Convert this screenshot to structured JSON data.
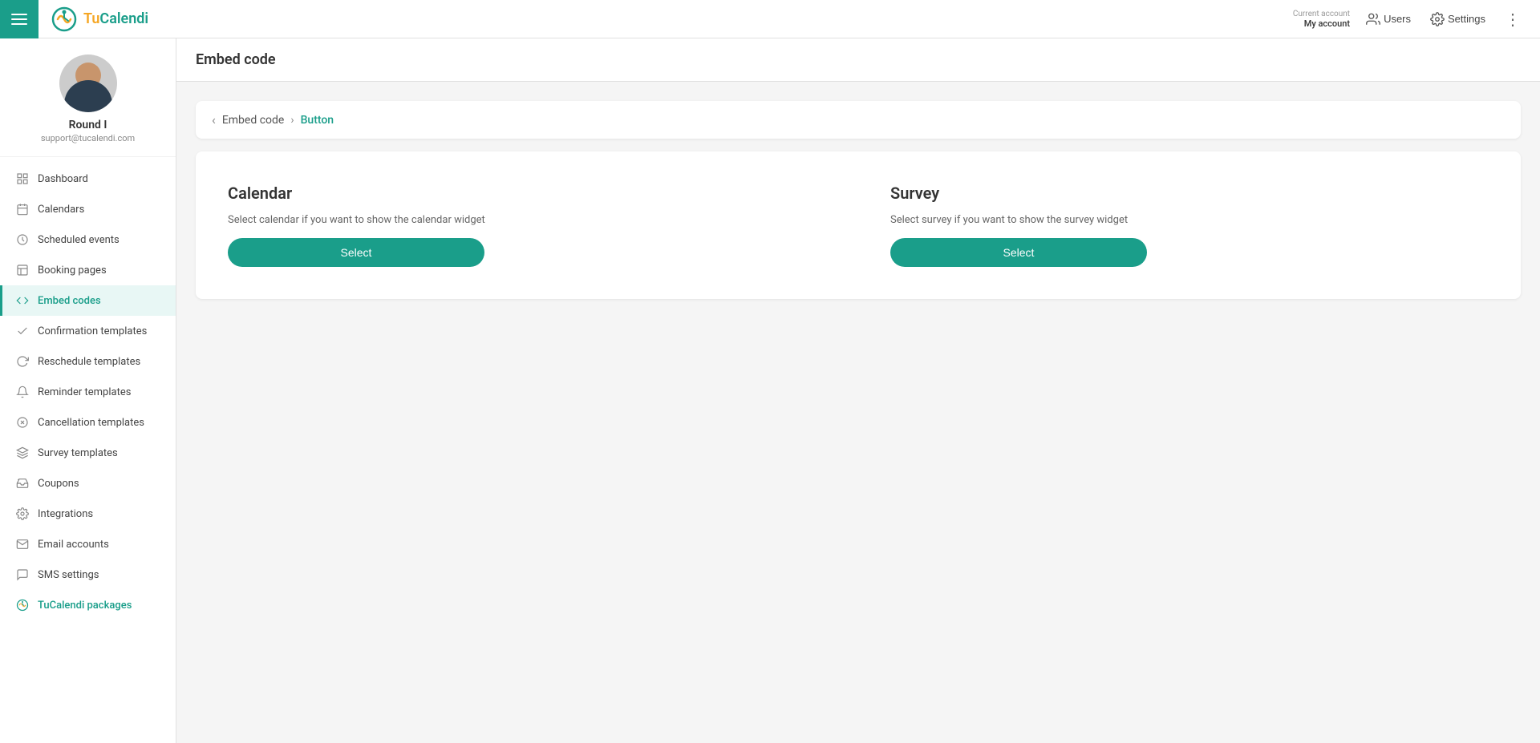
{
  "topbar": {
    "hamburger_label": "Menu",
    "logo_tu": "Tu",
    "logo_calendi": "Calendi",
    "account_label": "Current account",
    "account_name": "My account",
    "users_label": "Users",
    "settings_label": "Settings",
    "more_label": "More"
  },
  "sidebar": {
    "profile": {
      "name": "Round I",
      "email": "support@tucalendi.com"
    },
    "nav_items": [
      {
        "id": "dashboard",
        "label": "Dashboard",
        "icon": "grid"
      },
      {
        "id": "calendars",
        "label": "Calendars",
        "icon": "calendar"
      },
      {
        "id": "scheduled-events",
        "label": "Scheduled events",
        "icon": "clock"
      },
      {
        "id": "booking-pages",
        "label": "Booking pages",
        "icon": "bookmark"
      },
      {
        "id": "embed-codes",
        "label": "Embed codes",
        "icon": "code",
        "active": true
      },
      {
        "id": "confirmation-templates",
        "label": "Confirmation templates",
        "icon": "check"
      },
      {
        "id": "reschedule-templates",
        "label": "Reschedule templates",
        "icon": "refresh"
      },
      {
        "id": "reminder-templates",
        "label": "Reminder templates",
        "icon": "bell"
      },
      {
        "id": "cancellation-templates",
        "label": "Cancellation templates",
        "icon": "x-circle"
      },
      {
        "id": "survey-templates",
        "label": "Survey templates",
        "icon": "layers"
      },
      {
        "id": "coupons",
        "label": "Coupons",
        "icon": "inbox"
      },
      {
        "id": "integrations",
        "label": "Integrations",
        "icon": "settings"
      },
      {
        "id": "email-accounts",
        "label": "Email accounts",
        "icon": "mail"
      },
      {
        "id": "sms-settings",
        "label": "SMS settings",
        "icon": "message"
      },
      {
        "id": "tucalendi-packages",
        "label": "TuCalendi packages",
        "icon": "logo",
        "special": true
      }
    ]
  },
  "page": {
    "title": "Embed code",
    "breadcrumb": {
      "back_label": "‹",
      "parent": "Embed code",
      "current": "Button"
    },
    "calendar_option": {
      "title": "Calendar",
      "description": "Select calendar if you want to show the calendar widget",
      "button_label": "Select"
    },
    "survey_option": {
      "title": "Survey",
      "description": "Select survey if you want to show the survey widget",
      "button_label": "Select"
    }
  },
  "colors": {
    "primary": "#1a9e8a",
    "sidebar_active_bg": "#e8f7f5",
    "sidebar_active_border": "#1a9e8a"
  }
}
